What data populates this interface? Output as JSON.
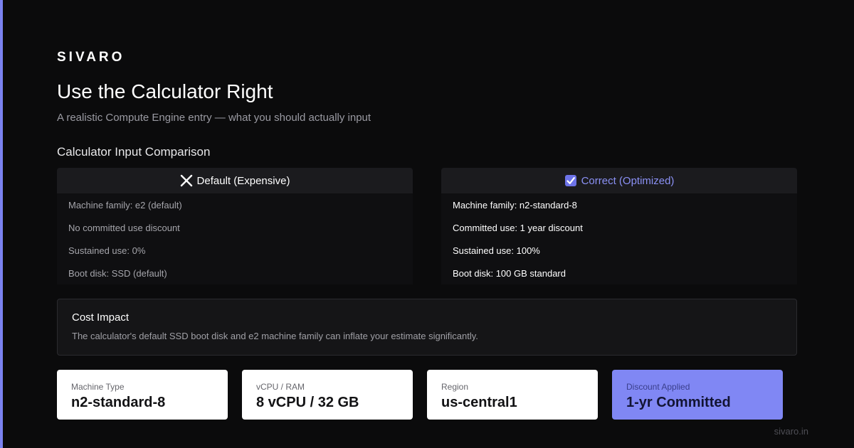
{
  "brand": "SIVARO",
  "title": "Use the Calculator Right",
  "subtitle": "A realistic Compute Engine entry — what you should actually input",
  "section_heading": "Calculator Input Comparison",
  "default_panel": {
    "icon": "x-icon",
    "label": "Default (Expensive)",
    "rows": [
      "Machine family: e2 (default)",
      "No committed use discount",
      "Sustained use: 0%",
      "Boot disk: SSD (default)"
    ]
  },
  "correct_panel": {
    "icon": "check-box-icon",
    "label": "Correct (Optimized)",
    "rows": [
      "Machine family: n2-standard-8",
      "Committed use: 1 year discount",
      "Sustained use: 100%",
      "Boot disk: 100 GB standard"
    ]
  },
  "impact": {
    "title": "Cost Impact",
    "text": "The calculator's default SSD boot disk and e2 machine family can inflate your estimate significantly."
  },
  "stats": [
    {
      "label": "Machine Type",
      "value": "n2-standard-8"
    },
    {
      "label": "vCPU / RAM",
      "value": "8 vCPU / 32 GB"
    },
    {
      "label": "Region",
      "value": "us-central1"
    },
    {
      "label": "Discount Applied",
      "value": "1-yr Committed"
    }
  ],
  "footer": "sivaro.in",
  "colors": {
    "accent": "#7b82f0",
    "background": "#0b0b0c",
    "highlight_card": "#8087f4"
  }
}
